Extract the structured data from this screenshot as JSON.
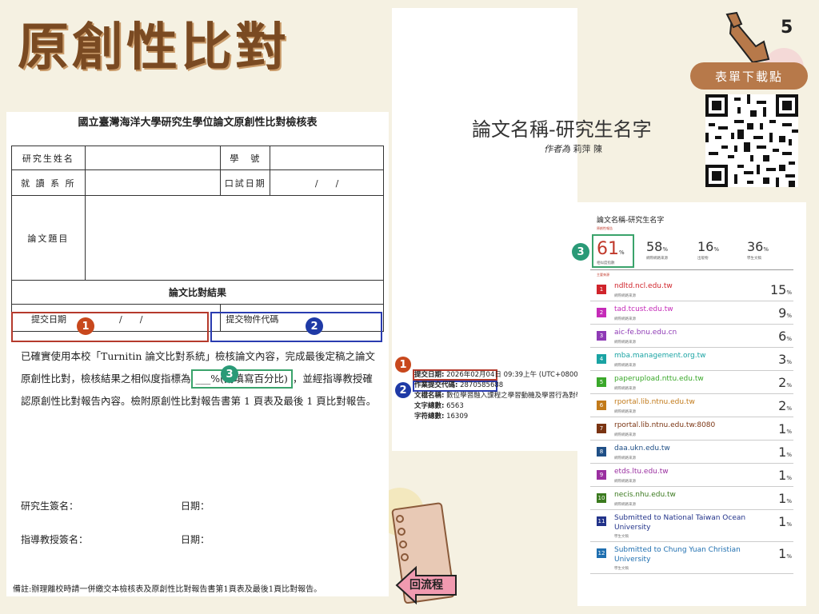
{
  "page": {
    "title": "原創性比對",
    "page_number": "5",
    "download_label": "表單下載點",
    "back_label": "回流程"
  },
  "form": {
    "heading": "國立臺灣海洋大學研究生學位論文原創性比對檢核表",
    "label_student_name": "研究生姓名",
    "label_student_id": "學　號",
    "label_department": "就 讀 系 所",
    "label_exam_date": "口試日期",
    "exam_date_value": "/　　/",
    "label_thesis_title": "論文題目",
    "section_result": "論文比對結果",
    "label_submit_date": "提交日期",
    "submit_date_value": "/　　/",
    "label_submission_id": "提交物件代碼",
    "statement_part1": "已確實使用本校「Turnitin 論文比對系統」檢核論文內容，完成最後定稿之論文原創性比對，檢核結果之相似度指標為",
    "statement_pct": "___%(請填寫百分比)",
    "statement_part2": "，並經指導教授確認原創性比對報告內容。檢附原創性比對報告書第 1 頁表及最後 1 頁比對報告。",
    "label_student_sign": "研究生簽名：",
    "label_advisor_sign": "指導教授簽名：",
    "label_date": "日期：",
    "footnote": "備註:辦理離校時請一併繳交本檢核表及原創性比對報告書第1頁表及最後1頁比對報告。"
  },
  "markers": {
    "one": "1",
    "two": "2",
    "three": "3"
  },
  "report": {
    "cover_title": "論文名稱-研究生名字",
    "author_prefix": "作者為",
    "author_name": "莉萍 陳",
    "submit_date_label": "提交日期:",
    "submit_date_value": "2026年02月04日",
    "submit_time": "09:39上午 (UTC+0800)",
    "submission_id_label": "作業提交代碼:",
    "submission_id_value": "2870585688",
    "filename_label": "文檔名稱:",
    "filename_value": "數位學習融入課程之學習動機及學習行為對學",
    "word_count_label": "文字總數:",
    "word_count_value": "6563",
    "char_count_label": "字符總數:",
    "char_count_value": "16309"
  },
  "similarity": {
    "title": "論文名稱-研究生名字",
    "section_label": "原創性報告",
    "sources_label": "主要來源",
    "index": {
      "value": "61",
      "unit": "%",
      "caption": "相似度指數"
    },
    "stats": [
      {
        "value": "58",
        "unit": "%",
        "caption": "網際網路來源"
      },
      {
        "value": "16",
        "unit": "%",
        "caption": "出版物"
      },
      {
        "value": "36",
        "unit": "%",
        "caption": "學生文稿"
      }
    ],
    "sources": [
      {
        "rank": "1",
        "name": "ndltd.ncl.edu.tw",
        "sub": "網際網路來源",
        "pct": "15",
        "color": "#d0242b"
      },
      {
        "rank": "2",
        "name": "tad.tcust.edu.tw",
        "sub": "網際網路來源",
        "pct": "9",
        "color": "#c52bb8"
      },
      {
        "rank": "3",
        "name": "aic-fe.bnu.edu.cn",
        "sub": "網際網路來源",
        "pct": "6",
        "color": "#8e3ab5"
      },
      {
        "rank": "4",
        "name": "mba.management.org.tw",
        "sub": "網際網路來源",
        "pct": "3",
        "color": "#1aa3a3"
      },
      {
        "rank": "5",
        "name": "paperupload.nttu.edu.tw",
        "sub": "網際網路來源",
        "pct": "2",
        "color": "#3aa82a"
      },
      {
        "rank": "6",
        "name": "rportal.lib.ntnu.edu.tw",
        "sub": "網際網路來源",
        "pct": "2",
        "color": "#c27a1a"
      },
      {
        "rank": "7",
        "name": "rportal.lib.ntnu.edu.tw:8080",
        "sub": "網際網路來源",
        "pct": "1",
        "color": "#7a3412"
      },
      {
        "rank": "8",
        "name": "daa.ukn.edu.tw",
        "sub": "網際網路來源",
        "pct": "1",
        "color": "#1f4f86"
      },
      {
        "rank": "9",
        "name": "etds.ltu.edu.tw",
        "sub": "網際網路來源",
        "pct": "1",
        "color": "#9a2fa0"
      },
      {
        "rank": "10",
        "name": "necis.nhu.edu.tw",
        "sub": "網際網路來源",
        "pct": "1",
        "color": "#3b7a1f"
      },
      {
        "rank": "11",
        "name": "Submitted to National Taiwan Ocean University",
        "sub": "學生文稿",
        "pct": "1",
        "color": "#22338a"
      },
      {
        "rank": "12",
        "name": "Submitted to Chung Yuan Christian University",
        "sub": "學生文稿",
        "pct": "1",
        "color": "#1f6fb0"
      }
    ]
  },
  "colors": {
    "title_brown": "#7a4a22",
    "pill": "#b7794a",
    "marker_red": "#c8481d",
    "marker_blue": "#1f3aa6",
    "marker_green": "#2a9a77",
    "similarity_red": "#c0392b"
  },
  "icons": [
    "hand-pointer-icon",
    "qr-code-icon",
    "back-arrow-icon",
    "notebook-decoration"
  ]
}
